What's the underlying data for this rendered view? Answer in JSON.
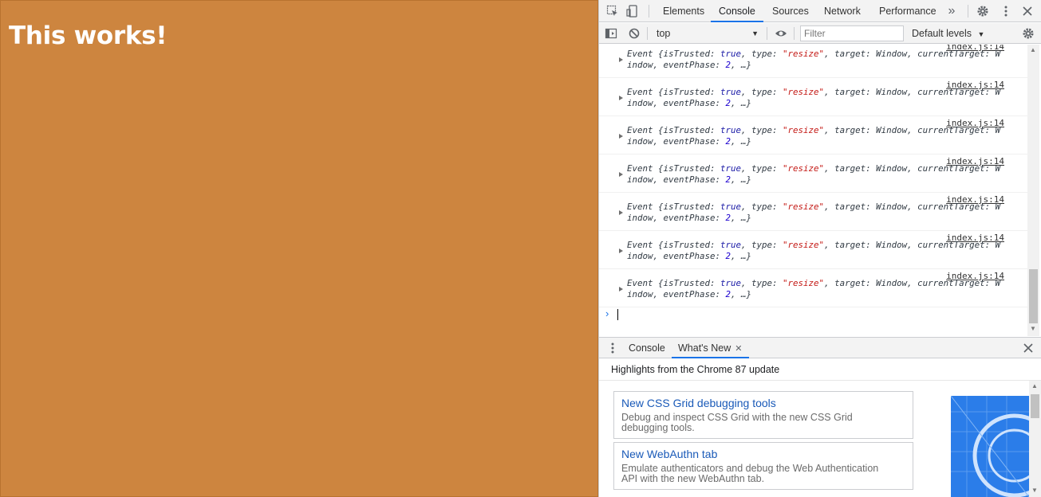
{
  "page": {
    "heading": "This works!",
    "background_color": "#cd853f"
  },
  "devtools": {
    "tabs": [
      {
        "label": "Elements"
      },
      {
        "label": "Console"
      },
      {
        "label": "Sources"
      },
      {
        "label": "Network"
      },
      {
        "label": "Performance"
      }
    ],
    "more_tabs_icon": "»",
    "toolbar": {
      "context": "top",
      "filter_placeholder": "Filter",
      "levels": "Default levels"
    },
    "console_messages": [
      {
        "source": "index.js:14",
        "line1_prefix": "Event {isTrusted: ",
        "v_true": "true",
        "sep1": ", type: ",
        "v_type": "\"resize\"",
        "line1_suffix": ", target: Window, currentTarget: W",
        "line2_prefix": "indow, eventPhase: ",
        "v_phase": "2",
        "line2_suffix": ", …}"
      },
      {
        "source": "index.js:14",
        "line1_prefix": "Event {isTrusted: ",
        "v_true": "true",
        "sep1": ", type: ",
        "v_type": "\"resize\"",
        "line1_suffix": ", target: Window, currentTarget: W",
        "line2_prefix": "indow, eventPhase: ",
        "v_phase": "2",
        "line2_suffix": ", …}"
      },
      {
        "source": "index.js:14",
        "line1_prefix": "Event {isTrusted: ",
        "v_true": "true",
        "sep1": ", type: ",
        "v_type": "\"resize\"",
        "line1_suffix": ", target: Window, currentTarget: W",
        "line2_prefix": "indow, eventPhase: ",
        "v_phase": "2",
        "line2_suffix": ", …}"
      },
      {
        "source": "index.js:14",
        "line1_prefix": "Event {isTrusted: ",
        "v_true": "true",
        "sep1": ", type: ",
        "v_type": "\"resize\"",
        "line1_suffix": ", target: Window, currentTarget: W",
        "line2_prefix": "indow, eventPhase: ",
        "v_phase": "2",
        "line2_suffix": ", …}"
      },
      {
        "source": "index.js:14",
        "line1_prefix": "Event {isTrusted: ",
        "v_true": "true",
        "sep1": ", type: ",
        "v_type": "\"resize\"",
        "line1_suffix": ", target: Window, currentTarget: W",
        "line2_prefix": "indow, eventPhase: ",
        "v_phase": "2",
        "line2_suffix": ", …}"
      },
      {
        "source": "index.js:14",
        "line1_prefix": "Event {isTrusted: ",
        "v_true": "true",
        "sep1": ", type: ",
        "v_type": "\"resize\"",
        "line1_suffix": ", target: Window, currentTarget: W",
        "line2_prefix": "indow, eventPhase: ",
        "v_phase": "2",
        "line2_suffix": ", …}"
      },
      {
        "source": "index.js:14",
        "line1_prefix": "Event {isTrusted: ",
        "v_true": "true",
        "sep1": ", type: ",
        "v_type": "\"resize\"",
        "line1_suffix": ", target: Window, currentTarget: W",
        "line2_prefix": "indow, eventPhase: ",
        "v_phase": "2",
        "line2_suffix": ", …}"
      }
    ],
    "drawer": {
      "tabs": [
        {
          "label": "Console"
        },
        {
          "label": "What's New"
        }
      ],
      "highlights": "Highlights from the Chrome 87 update",
      "cards": [
        {
          "title": "New CSS Grid debugging tools",
          "desc_line1": "Debug and inspect CSS Grid with the new CSS Grid",
          "desc_line2": "debugging tools."
        },
        {
          "title": "New WebAuthn tab",
          "desc_line1": "Emulate authenticators and debug the Web Authentication",
          "desc_line2": "API with the new WebAuthn tab."
        }
      ]
    },
    "colors": {
      "accent": "#1a73e8",
      "link": "#1a5ab8",
      "string": "#c41a16",
      "keyword": "#1a1aa6"
    }
  }
}
